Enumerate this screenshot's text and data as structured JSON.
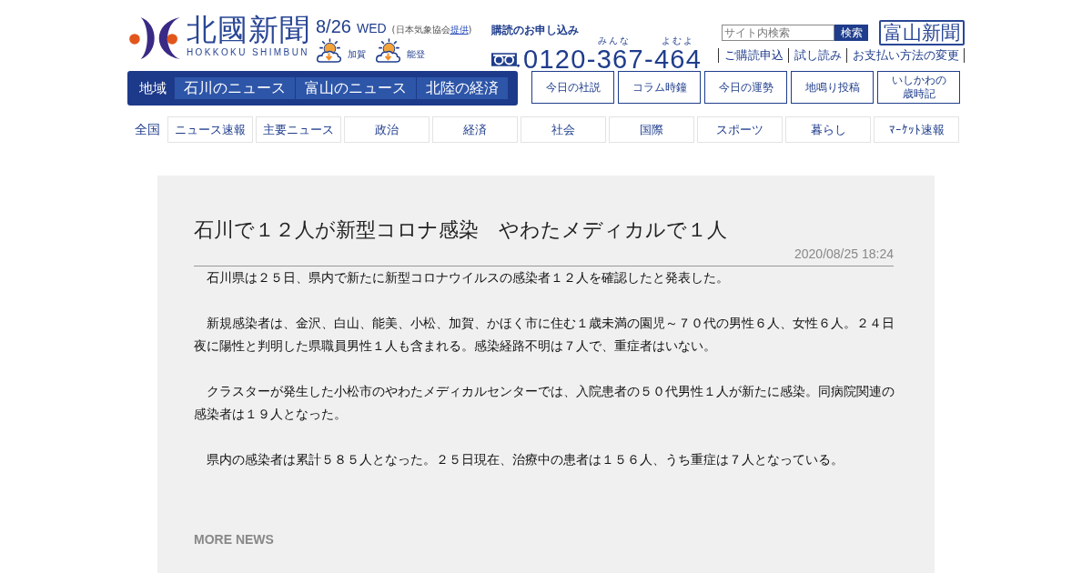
{
  "header": {
    "logo": {
      "title": "北國新聞",
      "subtitle": "HOKKOKU SHIMBUN"
    },
    "date": {
      "day": "8/26",
      "weekday": "WED",
      "credit": {
        "before": "(日本気象協会",
        "link": "提供",
        "after": ")"
      }
    },
    "weather": [
      {
        "region": "加賀"
      },
      {
        "region": "能登"
      }
    ],
    "subscription": {
      "heading": "購読のお申し込み",
      "ruby": [
        "みんな",
        "よむよ"
      ],
      "phone": "0120-367-464"
    },
    "search": {
      "placeholder": "サイト内検索",
      "button": "検索"
    },
    "toyama_link": "富山新聞",
    "links": [
      "ご購読申込",
      "試し読み",
      "お支払い方法の変更"
    ]
  },
  "region_nav": {
    "label": "地域",
    "tabs": [
      "石川のニュース",
      "富山のニュース",
      "北陸の経済"
    ]
  },
  "features": [
    "今日の社説",
    "コラム時鐘",
    "今日の運勢",
    "地鳴り投稿",
    "いしかわの歳時記"
  ],
  "national_nav": {
    "label": "全国",
    "items": [
      "ニュース速報",
      "主要ニュース",
      "政治",
      "経済",
      "社会",
      "国際",
      "スポーツ",
      "暮らし",
      "ﾏｰｹｯﾄ速報"
    ]
  },
  "article": {
    "title": "石川で１２人が新型コロナ感染　やわたメディカルで１人",
    "datetime": "2020/08/25 18:24",
    "paragraphs": [
      "石川県は２５日、県内で新たに新型コロナウイルスの感染者１２人を確認したと発表した。",
      "新規感染者は、金沢、白山、能美、小松、加賀、かほく市に住む１歳未満の園児～７０代の男性６人、女性６人。２４日夜に陽性と判明した県職員男性１人も含まれる。感染経路不明は７人で、重症者はいない。",
      "クラスターが発生した小松市のやわたメディカルセンターでは、入院患者の５０代男性１人が新たに感染。同病院関連の感染者は１９人となった。",
      "県内の感染者は累計５８５人となった。２５日現在、治療中の患者は１５６人、うち重症は７人となっている。"
    ],
    "more_news": "MORE NEWS"
  }
}
